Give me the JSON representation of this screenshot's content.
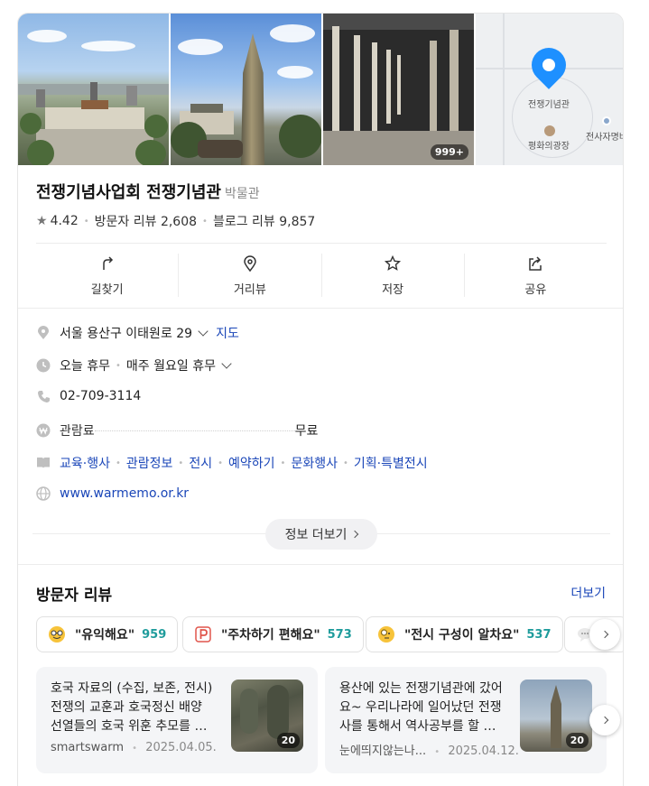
{
  "place": {
    "name": "전쟁기념사업회 전쟁기념관",
    "category": "박물관",
    "rating": "4.42",
    "visitor_reviews": "방문자 리뷰 2,608",
    "blog_reviews": "블로그 리뷰 9,857"
  },
  "photos": {
    "count_badge": "999+"
  },
  "map": {
    "pin_label": "전쟁기념관",
    "plaza_label": "평화의광장",
    "side_label": "전사자명비"
  },
  "actions": [
    {
      "label": "길찾기",
      "icon": "directions-icon"
    },
    {
      "label": "거리뷰",
      "icon": "streetview-icon"
    },
    {
      "label": "저장",
      "icon": "star-icon"
    },
    {
      "label": "공유",
      "icon": "share-icon"
    }
  ],
  "info": {
    "address": "서울 용산구 이태원로 29",
    "map_link": "지도",
    "hours_status": "오늘 휴무",
    "hours_detail": "매주 월요일 휴무",
    "phone": "02-709-3114",
    "fee_label": "관람료",
    "fee_value": "무료",
    "menu_links": [
      "교육·행사",
      "관람정보",
      "전시",
      "예약하기",
      "문화행사",
      "기획·특별전시"
    ],
    "website": "www.warmemo.or.kr",
    "more_info": "정보 더보기"
  },
  "reviews": {
    "title": "방문자 리뷰",
    "more": "더보기",
    "keywords": [
      {
        "label": "\"유익해요\"",
        "count": "959",
        "icon": "nerd-emoji-icon"
      },
      {
        "label": "\"주차하기 편해요\"",
        "count": "573",
        "icon": "parking-icon"
      },
      {
        "label": "\"전시 구성이 알차요\"",
        "count": "537",
        "icon": "magnifier-emoji-icon"
      }
    ],
    "cards": [
      {
        "text": "호국 자료의 (수집, 보존, 전시) 전쟁의 교훈과 호국정신 배양 선열들의 호국 위훈 추모를 목적으로 설립된 기관",
        "author": "smartswarm",
        "date": "2025.04.05.",
        "photo_count": "20"
      },
      {
        "text": "용산에 있는 전쟁기념관에 갔어요~ 우리나라에 일어났던 전쟁사를 통해서 역사공부를 할 수 있는 곳",
        "author": "눈에띄지않는나...",
        "date": "2025.04.12.",
        "photo_count": "20"
      }
    ]
  }
}
